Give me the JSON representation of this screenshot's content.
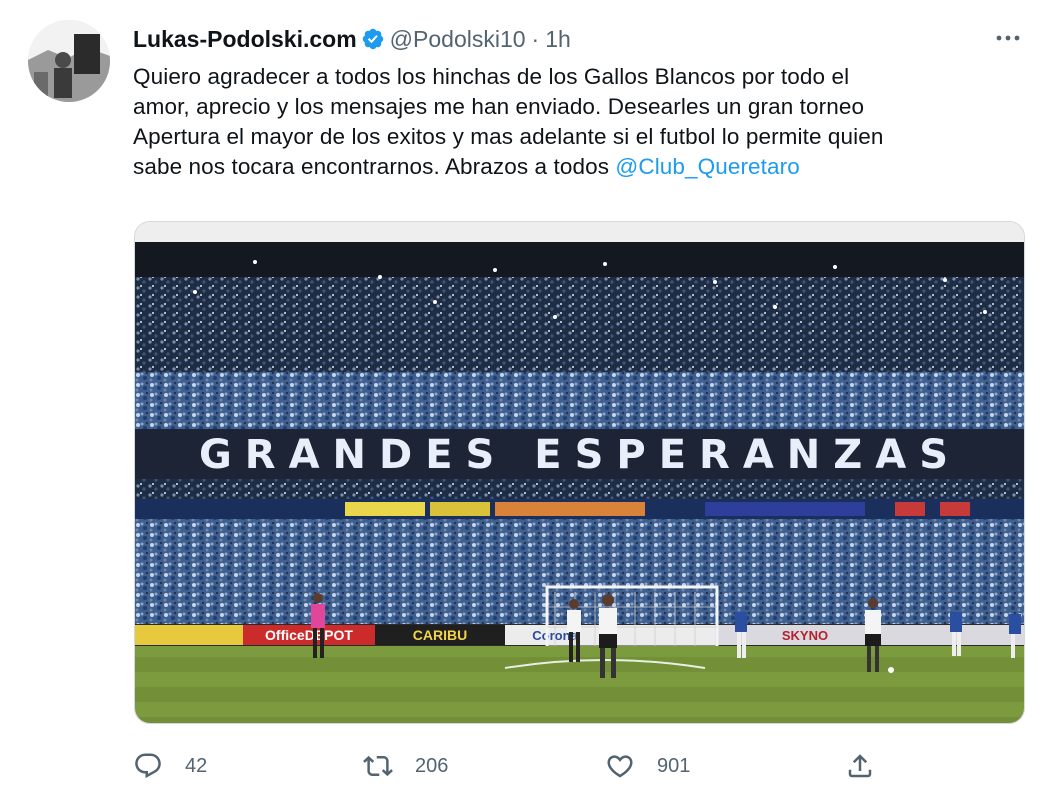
{
  "author": {
    "name": "Lukas-Podolski.com",
    "handle": "@Podolski10",
    "separator": "·",
    "time": "1h"
  },
  "tweet": {
    "text_lines": [
      "Quiero agradecer a todos los hinchas de los Gallos Blancos por todo el",
      "amor, aprecio y los mensajes me han enviado. Desearles un gran torneo",
      "Apertura el mayor de los exitos y mas adelante si el futbol lo permite quien",
      "sabe nos tocara encontrarnos. Abrazos a todos "
    ],
    "mention": "@Club_Queretaro"
  },
  "media": {
    "banner_text": "GRANDES ESPERANZAS",
    "ad_boards": [
      "OfficeDEPOT",
      "CARIBU",
      "Corona",
      "SKYNO"
    ]
  },
  "actions": {
    "reply_count": "42",
    "retweet_count": "206",
    "like_count": "901"
  },
  "icons": {
    "verified": "verified-badge-icon",
    "more": "more-options-icon",
    "reply": "reply-icon",
    "retweet": "retweet-icon",
    "like": "heart-icon",
    "share": "share-icon"
  },
  "colors": {
    "accent": "#1d9bf0",
    "text": "#0f1419",
    "secondary": "#536471"
  }
}
